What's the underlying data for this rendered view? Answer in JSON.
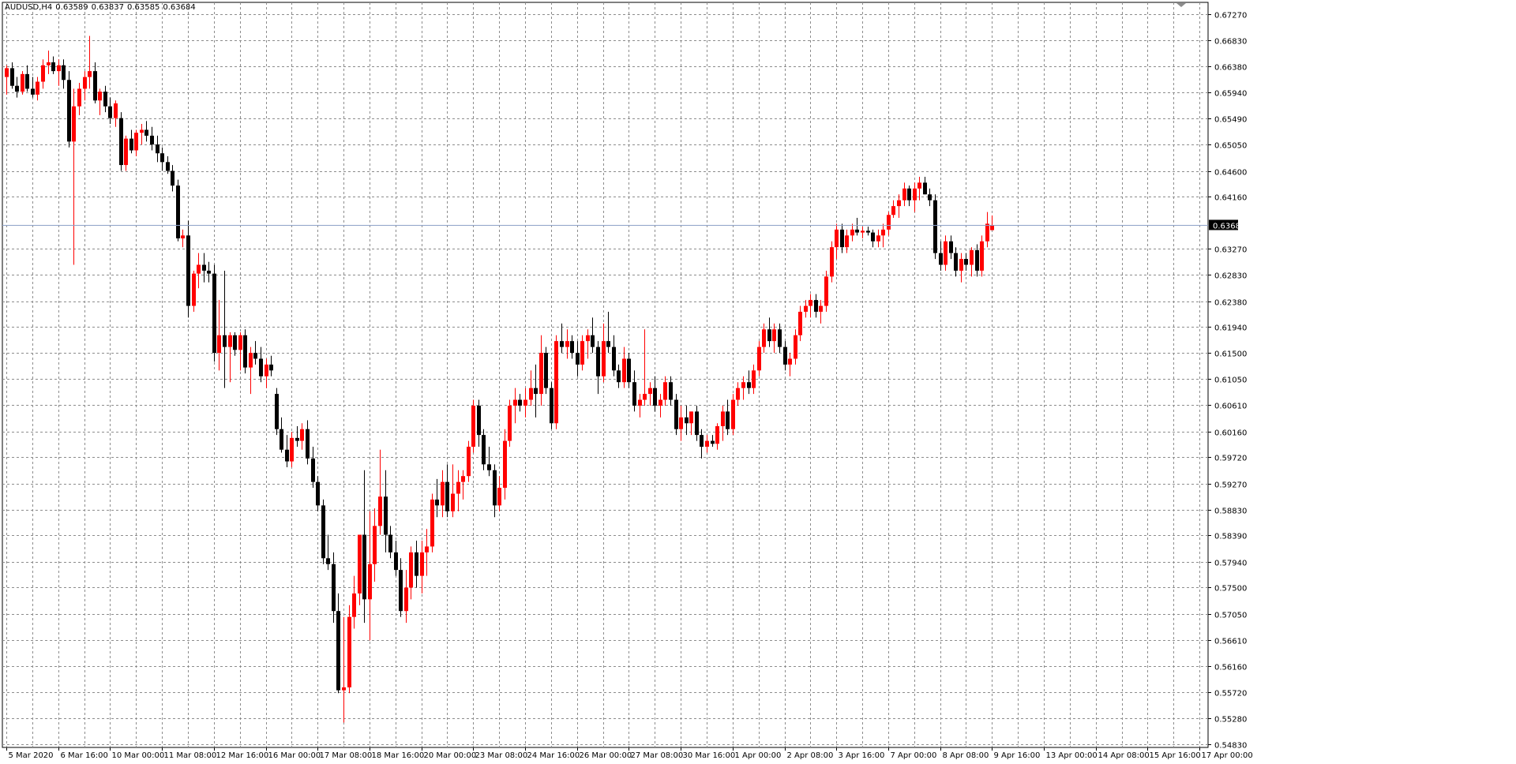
{
  "window": {
    "symbol": "AUDUSD,H4",
    "open": "0.63589",
    "high": "0.63837",
    "low": "0.63585",
    "close": "0.63684"
  },
  "colors": {
    "background": "#ffffff",
    "grid": "#8c8c8c",
    "bull_candle": "#ff0000",
    "bear_candle": "#000000",
    "bid_line": "#8ea2c8",
    "bid_label_bg": "#000000"
  },
  "icons": {
    "scroll_marker": "triangle-down-icon"
  },
  "chart_data": {
    "type": "candlestick",
    "title": "AUDUSD,H4",
    "bid_price": 0.63684,
    "ylim": [
      0.5483,
      0.6727
    ],
    "grid": true,
    "yticks": [
      "0.67270",
      "0.66830",
      "0.66380",
      "0.65940",
      "0.65490",
      "0.65050",
      "0.64600",
      "0.64160",
      "0.63270",
      "0.62830",
      "0.62380",
      "0.61940",
      "0.61500",
      "0.61050",
      "0.60610",
      "0.60160",
      "0.59720",
      "0.59270",
      "0.58830",
      "0.58390",
      "0.57940",
      "0.57500",
      "0.57050",
      "0.56610",
      "0.56160",
      "0.55720",
      "0.55280",
      "0.54830"
    ],
    "xticks": [
      {
        "label": "5 Mar 2020",
        "bar": 0
      },
      {
        "label": "6 Mar 16:00",
        "bar": 10
      },
      {
        "label": "10 Mar 00:00",
        "bar": 20
      },
      {
        "label": "11 Mar 08:00",
        "bar": 30
      },
      {
        "label": "12 Mar 16:00",
        "bar": 40
      },
      {
        "label": "16 Mar 00:00",
        "bar": 50
      },
      {
        "label": "17 Mar 08:00",
        "bar": 60
      },
      {
        "label": "18 Mar 16:00",
        "bar": 70
      },
      {
        "label": "20 Mar 00:00",
        "bar": 80
      },
      {
        "label": "23 Mar 08:00",
        "bar": 90
      },
      {
        "label": "24 Mar 16:00",
        "bar": 100
      },
      {
        "label": "26 Mar 00:00",
        "bar": 110
      },
      {
        "label": "27 Mar 08:00",
        "bar": 120
      },
      {
        "label": "30 Mar 16:00",
        "bar": 130
      },
      {
        "label": "1 Apr 00:00",
        "bar": 140
      },
      {
        "label": "2 Apr 08:00",
        "bar": 150
      },
      {
        "label": "3 Apr 16:00",
        "bar": 160
      },
      {
        "label": "7 Apr 00:00",
        "bar": 170
      },
      {
        "label": "8 Apr 08:00",
        "bar": 180
      },
      {
        "label": "9 Apr 16:00",
        "bar": 190
      },
      {
        "label": "13 Apr 00:00",
        "bar": 200
      },
      {
        "label": "14 Apr 08:00",
        "bar": 210
      },
      {
        "label": "15 Apr 16:00",
        "bar": 220
      },
      {
        "label": "17 Apr 00:00",
        "bar": 230
      }
    ],
    "ohlc": [
      [
        0.662,
        0.664,
        0.659,
        0.6635
      ],
      [
        0.6635,
        0.6645,
        0.66,
        0.6605
      ],
      [
        0.6605,
        0.662,
        0.6585,
        0.6595
      ],
      [
        0.6595,
        0.663,
        0.659,
        0.6625
      ],
      [
        0.6625,
        0.664,
        0.6595,
        0.66
      ],
      [
        0.66,
        0.662,
        0.6585,
        0.659
      ],
      [
        0.659,
        0.662,
        0.658,
        0.6612
      ],
      [
        0.6612,
        0.665,
        0.66,
        0.664
      ],
      [
        0.664,
        0.6665,
        0.6625,
        0.6645
      ],
      [
        0.6645,
        0.6655,
        0.6625,
        0.663
      ],
      [
        0.663,
        0.665,
        0.6605,
        0.664
      ],
      [
        0.664,
        0.665,
        0.66,
        0.6615
      ],
      [
        0.6615,
        0.663,
        0.65,
        0.651
      ],
      [
        0.651,
        0.66,
        0.63,
        0.657
      ],
      [
        0.657,
        0.661,
        0.6555,
        0.66
      ],
      [
        0.66,
        0.663,
        0.658,
        0.662
      ],
      [
        0.662,
        0.669,
        0.66,
        0.663
      ],
      [
        0.663,
        0.6645,
        0.6575,
        0.658
      ],
      [
        0.658,
        0.66,
        0.6555,
        0.6595
      ],
      [
        0.6595,
        0.6605,
        0.656,
        0.657
      ],
      [
        0.657,
        0.6585,
        0.654,
        0.655
      ],
      [
        0.655,
        0.658,
        0.6535,
        0.6575
      ],
      [
        0.655,
        0.656,
        0.646,
        0.647
      ],
      [
        0.647,
        0.652,
        0.646,
        0.6515
      ],
      [
        0.6515,
        0.653,
        0.649,
        0.6495
      ],
      [
        0.6495,
        0.653,
        0.6485,
        0.6525
      ],
      [
        0.6525,
        0.654,
        0.6505,
        0.653
      ],
      [
        0.653,
        0.6545,
        0.651,
        0.652
      ],
      [
        0.652,
        0.6535,
        0.6495,
        0.6505
      ],
      [
        0.6505,
        0.652,
        0.6475,
        0.649
      ],
      [
        0.649,
        0.65,
        0.646,
        0.6475
      ],
      [
        0.6475,
        0.6485,
        0.6455,
        0.646
      ],
      [
        0.646,
        0.647,
        0.6425,
        0.6435
      ],
      [
        0.6435,
        0.6445,
        0.634,
        0.6345
      ],
      [
        0.6345,
        0.636,
        0.633,
        0.635
      ],
      [
        0.635,
        0.6375,
        0.621,
        0.623
      ],
      [
        0.623,
        0.629,
        0.622,
        0.6285
      ],
      [
        0.6285,
        0.632,
        0.626,
        0.63
      ],
      [
        0.63,
        0.632,
        0.627,
        0.629
      ],
      [
        0.629,
        0.6305,
        0.627,
        0.6285
      ],
      [
        0.6285,
        0.63,
        0.6135,
        0.615
      ],
      [
        0.615,
        0.624,
        0.612,
        0.618
      ],
      [
        0.618,
        0.629,
        0.609,
        0.616
      ],
      [
        0.616,
        0.6185,
        0.61,
        0.618
      ],
      [
        0.618,
        0.6185,
        0.6145,
        0.6155
      ],
      [
        0.6155,
        0.6185,
        0.612,
        0.618
      ],
      [
        0.618,
        0.619,
        0.6115,
        0.6125
      ],
      [
        0.6125,
        0.616,
        0.608,
        0.615
      ],
      [
        0.615,
        0.617,
        0.613,
        0.614
      ],
      [
        0.614,
        0.616,
        0.61,
        0.611
      ],
      [
        0.611,
        0.614,
        0.609,
        0.613
      ],
      [
        0.613,
        0.6145,
        0.611,
        0.612
      ],
      [
        0.608,
        0.609,
        0.601,
        0.602
      ],
      [
        0.602,
        0.604,
        0.598,
        0.5985
      ],
      [
        0.5985,
        0.601,
        0.5955,
        0.5965
      ],
      [
        0.5965,
        0.6015,
        0.5955,
        0.6005
      ],
      [
        0.6005,
        0.6025,
        0.599,
        0.6
      ],
      [
        0.6,
        0.603,
        0.5985,
        0.602
      ],
      [
        0.602,
        0.6035,
        0.596,
        0.597
      ],
      [
        0.597,
        0.599,
        0.592,
        0.593
      ],
      [
        0.593,
        0.594,
        0.588,
        0.589
      ],
      [
        0.589,
        0.59,
        0.579,
        0.58
      ],
      [
        0.58,
        0.584,
        0.578,
        0.579
      ],
      [
        0.579,
        0.581,
        0.569,
        0.571
      ],
      [
        0.571,
        0.574,
        0.557,
        0.5575
      ],
      [
        0.5575,
        0.57,
        0.552,
        0.558
      ],
      [
        0.558,
        0.572,
        0.557,
        0.57
      ],
      [
        0.57,
        0.577,
        0.568,
        0.574
      ],
      [
        0.574,
        0.584,
        0.572,
        0.584
      ],
      [
        0.584,
        0.595,
        0.569,
        0.573
      ],
      [
        0.573,
        0.588,
        0.566,
        0.579
      ],
      [
        0.579,
        0.5885,
        0.576,
        0.5855
      ],
      [
        0.5855,
        0.5985,
        0.584,
        0.5905
      ],
      [
        0.5905,
        0.595,
        0.581,
        0.584
      ],
      [
        0.584,
        0.5855,
        0.58,
        0.581
      ],
      [
        0.581,
        0.583,
        0.577,
        0.578
      ],
      [
        0.578,
        0.58,
        0.57,
        0.571
      ],
      [
        0.571,
        0.578,
        0.569,
        0.575
      ],
      [
        0.575,
        0.582,
        0.573,
        0.581
      ],
      [
        0.581,
        0.583,
        0.575,
        0.577
      ],
      [
        0.577,
        0.583,
        0.574,
        0.581
      ],
      [
        0.581,
        0.585,
        0.577,
        0.582
      ],
      [
        0.582,
        0.591,
        0.581,
        0.59
      ],
      [
        0.59,
        0.5935,
        0.587,
        0.589
      ],
      [
        0.589,
        0.595,
        0.587,
        0.593
      ],
      [
        0.593,
        0.596,
        0.587,
        0.588
      ],
      [
        0.588,
        0.596,
        0.587,
        0.591
      ],
      [
        0.591,
        0.595,
        0.588,
        0.593
      ],
      [
        0.593,
        0.595,
        0.59,
        0.594
      ],
      [
        0.594,
        0.6,
        0.593,
        0.599
      ],
      [
        0.599,
        0.607,
        0.598,
        0.606
      ],
      [
        0.606,
        0.607,
        0.599,
        0.601
      ],
      [
        0.601,
        0.602,
        0.595,
        0.596
      ],
      [
        0.596,
        0.599,
        0.594,
        0.595
      ],
      [
        0.595,
        0.596,
        0.587,
        0.589
      ],
      [
        0.589,
        0.594,
        0.588,
        0.592
      ],
      [
        0.592,
        0.602,
        0.59,
        0.6
      ],
      [
        0.6,
        0.607,
        0.599,
        0.606
      ],
      [
        0.606,
        0.609,
        0.603,
        0.607
      ],
      [
        0.607,
        0.608,
        0.605,
        0.606
      ],
      [
        0.606,
        0.609,
        0.604,
        0.607
      ],
      [
        0.607,
        0.612,
        0.606,
        0.609
      ],
      [
        0.609,
        0.613,
        0.604,
        0.608
      ],
      [
        0.608,
        0.618,
        0.606,
        0.615
      ],
      [
        0.615,
        0.616,
        0.608,
        0.609
      ],
      [
        0.609,
        0.61,
        0.602,
        0.603
      ],
      [
        0.603,
        0.618,
        0.602,
        0.617
      ],
      [
        0.617,
        0.62,
        0.615,
        0.616
      ],
      [
        0.616,
        0.619,
        0.614,
        0.617
      ],
      [
        0.617,
        0.618,
        0.614,
        0.615
      ],
      [
        0.615,
        0.617,
        0.611,
        0.613
      ],
      [
        0.613,
        0.618,
        0.612,
        0.617
      ],
      [
        0.617,
        0.619,
        0.614,
        0.618
      ],
      [
        0.618,
        0.621,
        0.615,
        0.616
      ],
      [
        0.616,
        0.617,
        0.608,
        0.611
      ],
      [
        0.611,
        0.62,
        0.61,
        0.617
      ],
      [
        0.617,
        0.622,
        0.615,
        0.616
      ],
      [
        0.616,
        0.618,
        0.611,
        0.612
      ],
      [
        0.612,
        0.613,
        0.609,
        0.61
      ],
      [
        0.61,
        0.616,
        0.609,
        0.614
      ],
      [
        0.614,
        0.615,
        0.609,
        0.61
      ],
      [
        0.61,
        0.612,
        0.605,
        0.606
      ],
      [
        0.606,
        0.608,
        0.604,
        0.607
      ],
      [
        0.607,
        0.619,
        0.606,
        0.608
      ],
      [
        0.608,
        0.61,
        0.606,
        0.609
      ],
      [
        0.609,
        0.611,
        0.605,
        0.606
      ],
      [
        0.606,
        0.608,
        0.604,
        0.607
      ],
      [
        0.607,
        0.611,
        0.606,
        0.61
      ],
      [
        0.61,
        0.611,
        0.606,
        0.607
      ],
      [
        0.607,
        0.608,
        0.601,
        0.602
      ],
      [
        0.602,
        0.606,
        0.6,
        0.604
      ],
      [
        0.604,
        0.606,
        0.601,
        0.603
      ],
      [
        0.603,
        0.605,
        0.601,
        0.605
      ],
      [
        0.605,
        0.606,
        0.6,
        0.601
      ],
      [
        0.601,
        0.602,
        0.597,
        0.599
      ],
      [
        0.599,
        0.601,
        0.598,
        0.6
      ],
      [
        0.6,
        0.601,
        0.599,
        0.5995
      ],
      [
        0.5995,
        0.603,
        0.5985,
        0.6025
      ],
      [
        0.6025,
        0.606,
        0.6,
        0.605
      ],
      [
        0.605,
        0.607,
        0.601,
        0.602
      ],
      [
        0.602,
        0.608,
        0.601,
        0.607
      ],
      [
        0.607,
        0.61,
        0.606,
        0.609
      ],
      [
        0.609,
        0.611,
        0.607,
        0.61
      ],
      [
        0.61,
        0.612,
        0.608,
        0.609
      ],
      [
        0.609,
        0.613,
        0.608,
        0.612
      ],
      [
        0.612,
        0.617,
        0.611,
        0.616
      ],
      [
        0.616,
        0.62,
        0.615,
        0.619
      ],
      [
        0.619,
        0.621,
        0.616,
        0.617
      ],
      [
        0.617,
        0.62,
        0.615,
        0.619
      ],
      [
        0.619,
        0.62,
        0.615,
        0.616
      ],
      [
        0.616,
        0.617,
        0.612,
        0.613
      ],
      [
        0.613,
        0.615,
        0.611,
        0.614
      ],
      [
        0.614,
        0.619,
        0.613,
        0.618
      ],
      [
        0.618,
        0.623,
        0.617,
        0.622
      ],
      [
        0.622,
        0.624,
        0.621,
        0.623
      ],
      [
        0.623,
        0.625,
        0.621,
        0.624
      ],
      [
        0.624,
        0.625,
        0.621,
        0.622
      ],
      [
        0.622,
        0.624,
        0.62,
        0.623
      ],
      [
        0.623,
        0.629,
        0.622,
        0.628
      ],
      [
        0.628,
        0.634,
        0.627,
        0.633
      ],
      [
        0.633,
        0.637,
        0.631,
        0.636
      ],
      [
        0.636,
        0.637,
        0.632,
        0.633
      ],
      [
        0.633,
        0.636,
        0.632,
        0.635
      ],
      [
        0.635,
        0.637,
        0.634,
        0.636
      ],
      [
        0.636,
        0.638,
        0.635,
        0.6355
      ],
      [
        0.6355,
        0.6365,
        0.6345,
        0.6358
      ],
      [
        0.6358,
        0.6365,
        0.635,
        0.6355
      ],
      [
        0.6355,
        0.636,
        0.633,
        0.634
      ],
      [
        0.634,
        0.636,
        0.633,
        0.635
      ],
      [
        0.635,
        0.637,
        0.633,
        0.636
      ],
      [
        0.636,
        0.639,
        0.635,
        0.6385
      ],
      [
        0.6385,
        0.641,
        0.638,
        0.64
      ],
      [
        0.64,
        0.642,
        0.638,
        0.641
      ],
      [
        0.641,
        0.644,
        0.64,
        0.643
      ],
      [
        0.643,
        0.6435,
        0.64,
        0.641
      ],
      [
        0.641,
        0.644,
        0.639,
        0.643
      ],
      [
        0.643,
        0.645,
        0.641,
        0.644
      ],
      [
        0.644,
        0.645,
        0.642,
        0.642
      ],
      [
        0.642,
        0.643,
        0.64,
        0.641
      ],
      [
        0.641,
        0.642,
        0.631,
        0.632
      ],
      [
        0.632,
        0.634,
        0.629,
        0.63
      ],
      [
        0.63,
        0.635,
        0.629,
        0.634
      ],
      [
        0.634,
        0.635,
        0.631,
        0.632
      ],
      [
        0.632,
        0.633,
        0.628,
        0.629
      ],
      [
        0.629,
        0.632,
        0.627,
        0.631
      ],
      [
        0.631,
        0.632,
        0.629,
        0.63
      ],
      [
        0.63,
        0.633,
        0.628,
        0.6325
      ],
      [
        0.6325,
        0.6335,
        0.628,
        0.629
      ],
      [
        0.629,
        0.635,
        0.628,
        0.634
      ],
      [
        0.634,
        0.639,
        0.633,
        0.637
      ],
      [
        0.6359,
        0.6384,
        0.6359,
        0.6368
      ]
    ]
  }
}
